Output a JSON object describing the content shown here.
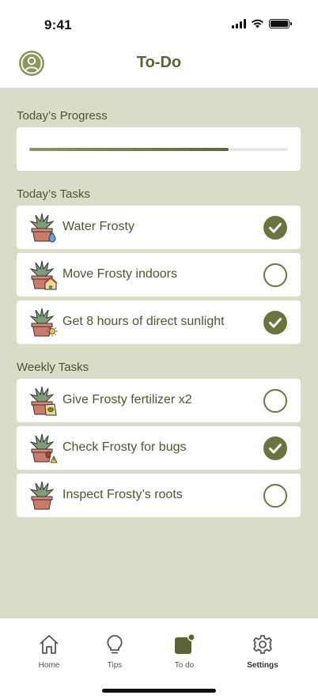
{
  "status_bar": {
    "time": "9:41"
  },
  "header": {
    "title": "To-Do",
    "avatar_icon": "user-avatar-icon"
  },
  "progress": {
    "label": "Today’s Progress",
    "value_fraction": 0.77
  },
  "today": {
    "label": "Today’s Tasks",
    "tasks": [
      {
        "label": "Water Frosty",
        "done": true,
        "icon": "plant-water-icon"
      },
      {
        "label": "Move Frosty indoors",
        "done": false,
        "icon": "plant-house-icon"
      },
      {
        "label": "Get 8 hours of direct sunlight",
        "done": true,
        "icon": "plant-sun-icon"
      }
    ]
  },
  "weekly": {
    "label": "Weekly Tasks",
    "tasks": [
      {
        "label": "Give Frosty fertilizer x2",
        "done": false,
        "icon": "plant-fertilizer-icon"
      },
      {
        "label": "Check Frosty for bugs",
        "done": true,
        "icon": "plant-bug-icon"
      },
      {
        "label": "Inspect Frosty’s roots",
        "done": false,
        "icon": "plant-icon"
      }
    ]
  },
  "tabs": [
    {
      "label": "Home",
      "icon": "home-icon"
    },
    {
      "label": "Tips",
      "icon": "lightbulb-icon"
    },
    {
      "label": "To do",
      "icon": "todo-icon"
    },
    {
      "label": "Settings",
      "icon": "gear-icon"
    }
  ],
  "colors": {
    "accent": "#6a7440",
    "background": "#d9dcc6",
    "title": "#5b6336"
  }
}
